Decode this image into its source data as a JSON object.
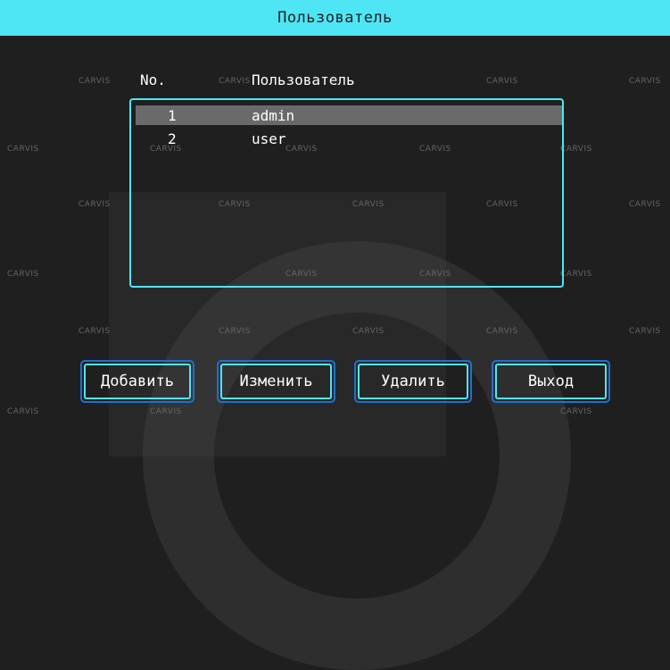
{
  "title": "Пользователь",
  "columns": {
    "no": "No.",
    "user": "Пользователь"
  },
  "users": [
    {
      "no": "1",
      "name": "admin",
      "selected": true
    },
    {
      "no": "2",
      "name": "user",
      "selected": false
    }
  ],
  "buttons": {
    "add": "Добавить",
    "edit": "Изменить",
    "delete": "Удалить",
    "exit": "Выход"
  },
  "watermark": "CARVIS",
  "colors": {
    "accent": "#4ee6f5",
    "button_outer": "#1f6fd0",
    "background": "#1f1f1f",
    "selection": "#6a6a6a"
  }
}
